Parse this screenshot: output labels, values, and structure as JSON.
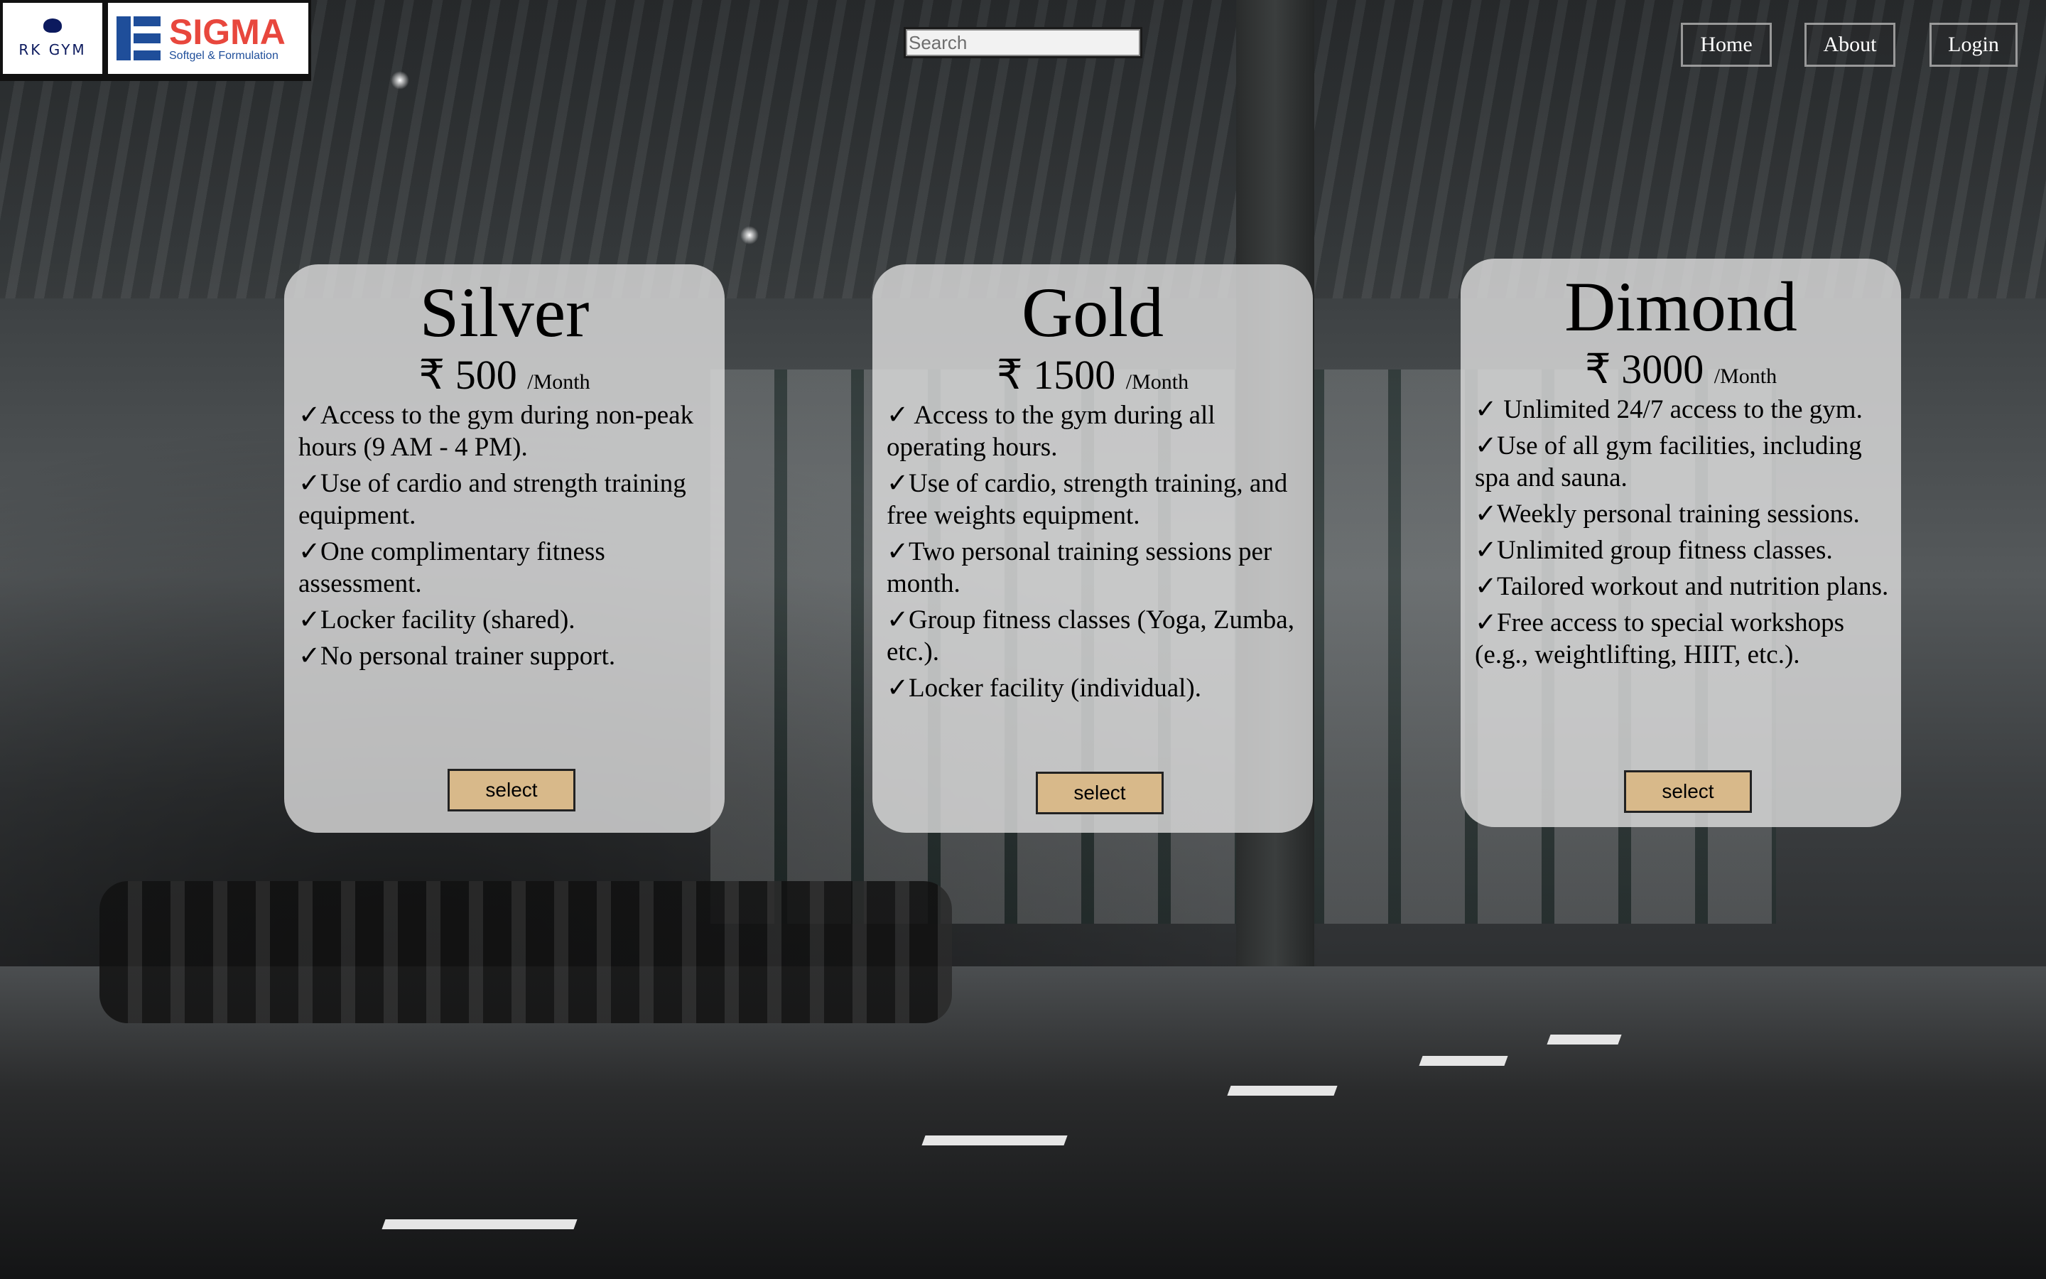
{
  "brand": {
    "rk_logo_text": "RK GYM",
    "sigma_logo_title": "SIGMA",
    "sigma_logo_subtitle": "Softgel & Formulation"
  },
  "search": {
    "placeholder": "Search"
  },
  "nav": {
    "home": "Home",
    "about": "About",
    "login": "Login"
  },
  "plans": [
    {
      "name": "Silver",
      "price": "₹ 500",
      "per": "/Month",
      "features": [
        "✓Access to the gym during non-peak hours (9 AM - 4 PM).",
        "✓Use of cardio and strength training equipment.",
        "✓One complimentary fitness assessment.",
        "✓Locker facility (shared).",
        "✓No personal trainer support."
      ],
      "button": "select"
    },
    {
      "name": "Gold",
      "price": "₹ 1500",
      "per": "/Month",
      "features": [
        "✓ Access to the gym during all operating hours.",
        "✓Use of cardio, strength training, and free weights equipment.",
        "✓Two personal training sessions per month.",
        "✓Group fitness classes (Yoga, Zumba, etc.).",
        "✓Locker facility (individual)."
      ],
      "button": "select"
    },
    {
      "name": "Dimond",
      "price": "₹ 3000",
      "per": "/Month",
      "features": [
        "✓ Unlimited 24/7 access to the gym.",
        "✓Use of all gym facilities, including spa and sauna.",
        "✓Weekly personal training sessions.",
        "✓Unlimited group fitness classes.",
        "✓Tailored workout and nutrition plans.",
        "✓Free access to special workshops (e.g., weightlifting, HIIT, etc.)."
      ],
      "button": "select"
    }
  ],
  "colors": {
    "card_background": "#dcdcdc",
    "select_button": "#d8b98a",
    "sigma_red": "#e8473d",
    "sigma_blue": "#1f4e9a",
    "rk_navy": "#0c1a5e"
  }
}
